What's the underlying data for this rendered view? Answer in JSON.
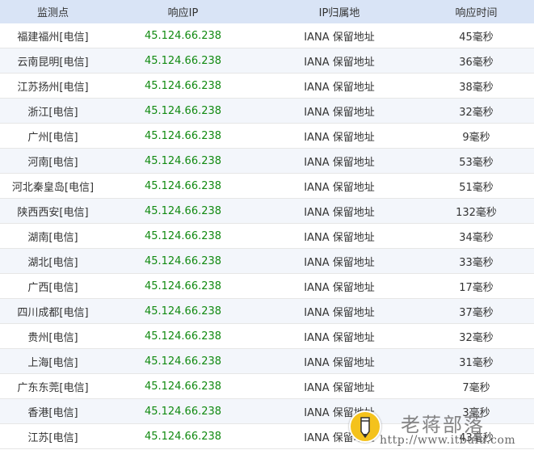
{
  "table": {
    "headers": [
      "监测点",
      "响应IP",
      "IP归属地",
      "响应时间"
    ],
    "rows": [
      {
        "node": "福建福州[电信]",
        "ip": "45.124.66.238",
        "location": "IANA 保留地址",
        "time": "45毫秒"
      },
      {
        "node": "云南昆明[电信]",
        "ip": "45.124.66.238",
        "location": "IANA 保留地址",
        "time": "36毫秒"
      },
      {
        "node": "江苏扬州[电信]",
        "ip": "45.124.66.238",
        "location": "IANA 保留地址",
        "time": "38毫秒"
      },
      {
        "node": "浙江[电信]",
        "ip": "45.124.66.238",
        "location": "IANA 保留地址",
        "time": "32毫秒"
      },
      {
        "node": "广州[电信]",
        "ip": "45.124.66.238",
        "location": "IANA 保留地址",
        "time": "9毫秒"
      },
      {
        "node": "河南[电信]",
        "ip": "45.124.66.238",
        "location": "IANA 保留地址",
        "time": "53毫秒"
      },
      {
        "node": "河北秦皇岛[电信]",
        "ip": "45.124.66.238",
        "location": "IANA 保留地址",
        "time": "51毫秒"
      },
      {
        "node": "陕西西安[电信]",
        "ip": "45.124.66.238",
        "location": "IANA 保留地址",
        "time": "132毫秒"
      },
      {
        "node": "湖南[电信]",
        "ip": "45.124.66.238",
        "location": "IANA 保留地址",
        "time": "34毫秒"
      },
      {
        "node": "湖北[电信]",
        "ip": "45.124.66.238",
        "location": "IANA 保留地址",
        "time": "33毫秒"
      },
      {
        "node": "广西[电信]",
        "ip": "45.124.66.238",
        "location": "IANA 保留地址",
        "time": "17毫秒"
      },
      {
        "node": "四川成都[电信]",
        "ip": "45.124.66.238",
        "location": "IANA 保留地址",
        "time": "37毫秒"
      },
      {
        "node": "贵州[电信]",
        "ip": "45.124.66.238",
        "location": "IANA 保留地址",
        "time": "32毫秒"
      },
      {
        "node": "上海[电信]",
        "ip": "45.124.66.238",
        "location": "IANA 保留地址",
        "time": "31毫秒"
      },
      {
        "node": "广东东莞[电信]",
        "ip": "45.124.66.238",
        "location": "IANA 保留地址",
        "time": "7毫秒"
      },
      {
        "node": "香港[电信]",
        "ip": "45.124.66.238",
        "location": "IANA 保留地址",
        "time": "3毫秒"
      },
      {
        "node": "江苏[电信]",
        "ip": "45.124.66.238",
        "location": "IANA 保留地址",
        "time": "43毫秒"
      }
    ]
  },
  "colors": {
    "header_bg": "#d9e4f6",
    "ip_text": "#118a11",
    "row_alt_bg": "#f3f6fb"
  },
  "watermark": {
    "title": "老蒋部落",
    "url": "http://www.itbulu.com",
    "icon": "pencil-logo-icon"
  }
}
